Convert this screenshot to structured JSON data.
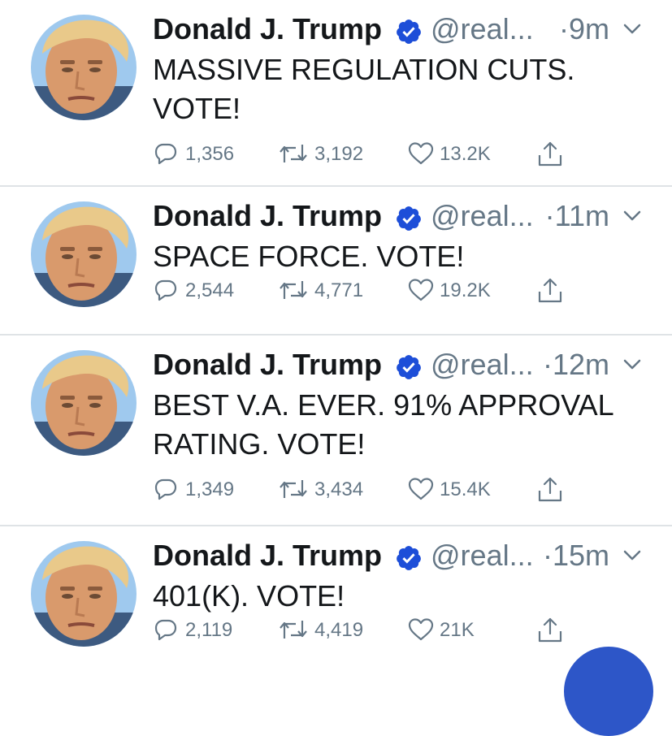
{
  "colors": {
    "text": "#14171a",
    "secondary": "#657786",
    "verified": "#1d4ed8",
    "divider": "#dfe3e6",
    "fab": "#2d56c8"
  },
  "tweets": [
    {
      "name": "Donald J. Trump",
      "handle": "@real...",
      "time": "·9m",
      "text": "MASSIVE REGULATION CUTS. VOTE!",
      "replies": "1,356",
      "retweets": "3,192",
      "likes": "13.2K",
      "icons": [
        "verified-badge-icon",
        "chevron-down-icon",
        "reply-icon",
        "retweet-icon",
        "like-icon",
        "share-icon"
      ]
    },
    {
      "name": "Donald J. Trump",
      "handle": "@real...",
      "time": "·11m",
      "text": "SPACE FORCE. VOTE!",
      "replies": "2,544",
      "retweets": "4,771",
      "likes": "19.2K",
      "icons": [
        "verified-badge-icon",
        "chevron-down-icon",
        "reply-icon",
        "retweet-icon",
        "like-icon",
        "share-icon"
      ]
    },
    {
      "name": "Donald J. Trump",
      "handle": "@real...",
      "time": "·12m",
      "text": "BEST V.A. EVER. 91% APPROVAL RATING. VOTE!",
      "replies": "1,349",
      "retweets": "3,434",
      "likes": "15.4K",
      "icons": [
        "verified-badge-icon",
        "chevron-down-icon",
        "reply-icon",
        "retweet-icon",
        "like-icon",
        "share-icon"
      ]
    },
    {
      "name": "Donald J. Trump",
      "handle": "@real...",
      "time": "·15m",
      "text": "401(K). VOTE!",
      "replies": "2,119",
      "retweets": "4,419",
      "likes": "21K",
      "icons": [
        "verified-badge-icon",
        "chevron-down-icon",
        "reply-icon",
        "retweet-icon",
        "like-icon",
        "share-icon"
      ]
    }
  ]
}
